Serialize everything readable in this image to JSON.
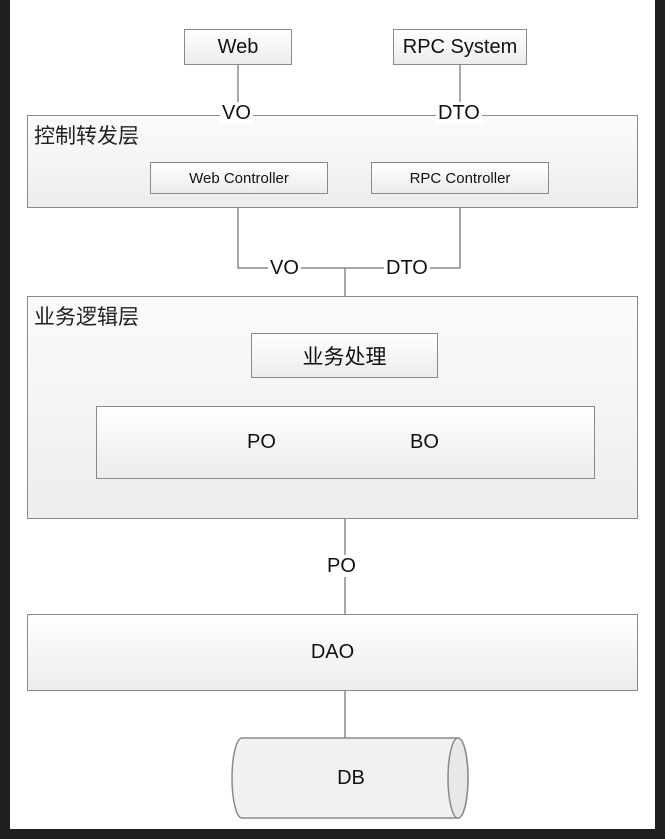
{
  "clients": {
    "web": "Web",
    "rpc": "RPC System"
  },
  "top_labels": {
    "vo": "VO",
    "dto": "DTO"
  },
  "control_layer": {
    "title": "控制转发层",
    "web_controller": "Web Controller",
    "rpc_controller": "RPC Controller"
  },
  "mid_labels": {
    "vo": "VO",
    "dto": "DTO"
  },
  "business_layer": {
    "title": "业务逻辑层",
    "processing": "业务处理",
    "po": "PO",
    "bo": "BO"
  },
  "po_label": "PO",
  "dao": "DAO",
  "db": "DB",
  "colors": {
    "line": "#8a8a8a",
    "background": "#1f1f1f",
    "canvas": "#ffffff"
  }
}
